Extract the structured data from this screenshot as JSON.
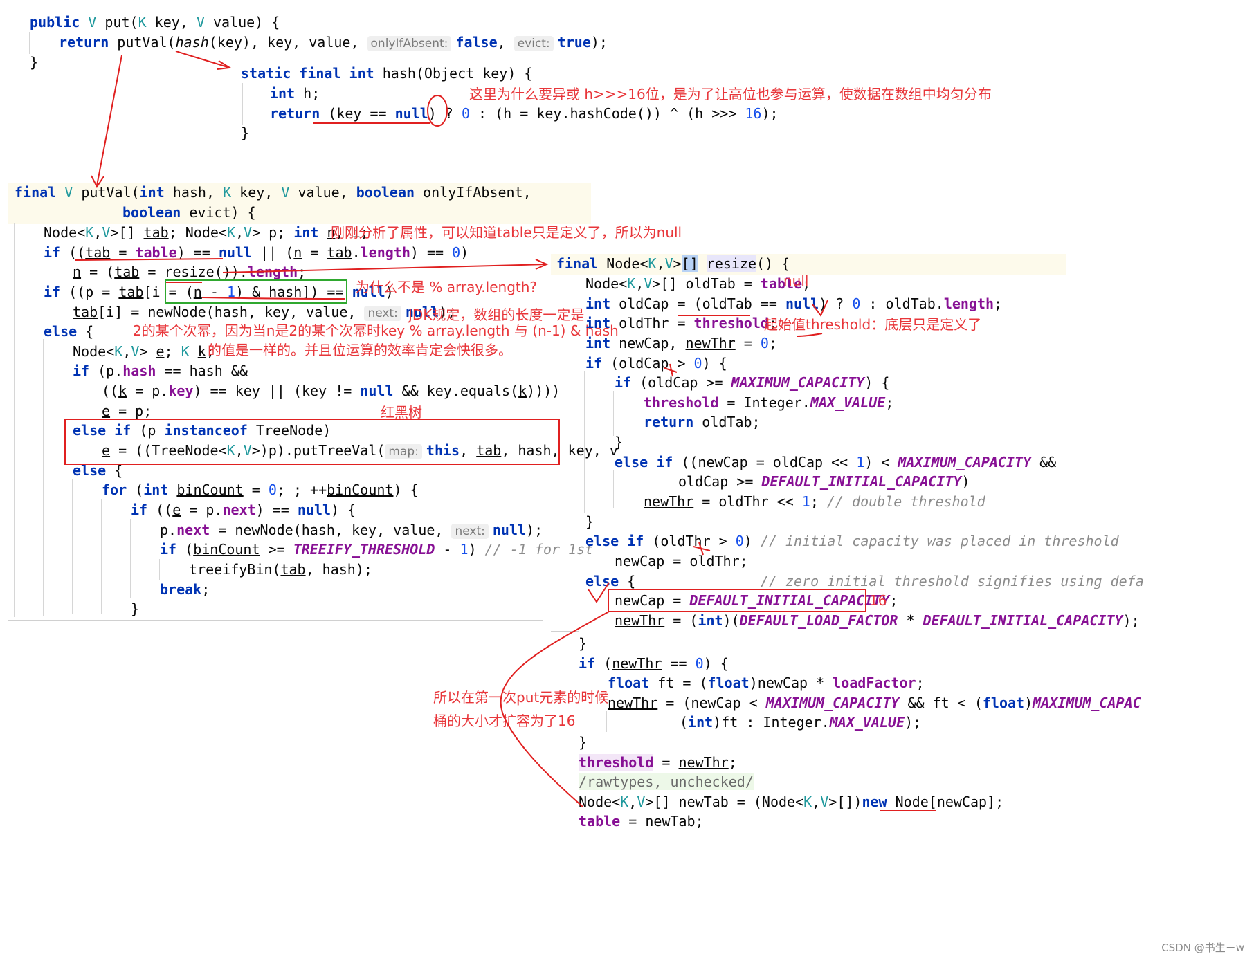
{
  "annotations": {
    "hash_reason": "这里为什么要异或 h>>>16位，是为了让高位也参与运算，使数据在数组中均匀分布",
    "table_null": "刚刚分析了属性，可以知道table只是定义了，所以为null",
    "why_not_mod": "为什么不是 % array.length?",
    "jdk_rule_1": "JDK规定，数组的长度一定是",
    "jdk_rule_2": "2的某个次幂，因为当n是2的某个次幂时key % array.length 与 (n-1) & hash",
    "jdk_rule_3": "的值是一样的。并且位运算的效率肯定会快很多。",
    "red_black_tree": "红黑树",
    "old_tab_null": "null",
    "threshold_note": "起始值threshold：底层只是定义了",
    "sixteen": "16",
    "first_put_1": "所以在第一次put元素的时候",
    "first_put_2": "桶的大小才扩容为了16"
  },
  "hints": {
    "only_if_absent": "onlyIfAbsent:",
    "evict": "evict:",
    "next": "next:",
    "map": "map:"
  },
  "watermark": "CSDN @书生－w"
}
